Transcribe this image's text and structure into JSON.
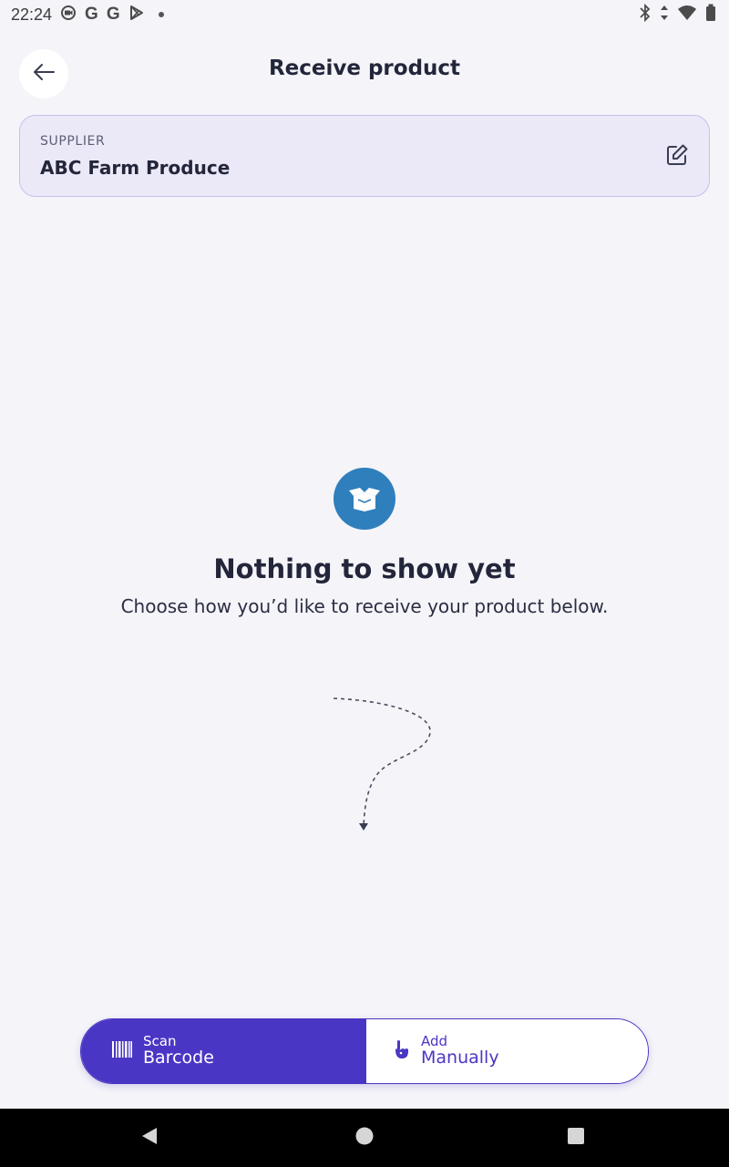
{
  "status_bar": {
    "time": "22:24",
    "left_icons": [
      "screen-record-icon",
      "google-icon",
      "google-icon",
      "play-store-icon",
      "dot-icon"
    ],
    "right_icons": [
      "bluetooth-icon",
      "data-arrows-icon",
      "wifi-icon",
      "battery-icon"
    ],
    "google_glyph": "G"
  },
  "header": {
    "title": "Receive product",
    "back_icon": "arrow-left-icon"
  },
  "supplier": {
    "label": "SUPPLIER",
    "name": "ABC Farm Produce",
    "edit_icon": "edit-icon"
  },
  "empty_state": {
    "icon": "open-box-icon",
    "title": "Nothing to show yet",
    "subtitle": "Choose how you’d like to receive your product below."
  },
  "actions": {
    "scan": {
      "small_label": "Scan",
      "large_label": "Barcode",
      "icon": "barcode-icon"
    },
    "manual": {
      "small_label": "Add",
      "large_label": "Manually",
      "icon": "hand-pointer-icon"
    }
  },
  "colors": {
    "primary": "#4a36c4",
    "icon_blue": "#2f7fbc",
    "background": "#f4f4f9",
    "card_bg": "#ebe9f8",
    "text": "#23263a"
  },
  "nav_bar": {
    "buttons": [
      "back-triangle-icon",
      "home-circle-icon",
      "recents-square-icon"
    ]
  }
}
